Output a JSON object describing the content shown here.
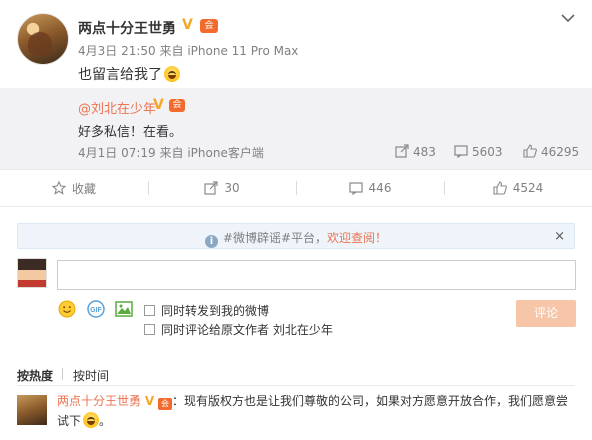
{
  "post": {
    "author": "两点十分王世勇",
    "time": "4月3日 21:50",
    "source_prefix": "来自",
    "source": "iPhone 11 Pro Max",
    "text": "也留言给我了"
  },
  "quoted": {
    "author": "@刘北在少年",
    "text": "好多私信！在看。",
    "time": "4月1日 07:19",
    "source_prefix": "来自",
    "source": "iPhone客户端",
    "reposts": "483",
    "comments": "5603",
    "likes": "46295"
  },
  "actions": {
    "favorite": "收藏",
    "repost": "30",
    "comment": "446",
    "like": "4524"
  },
  "notice": {
    "prefix": "#微博辟谣#平台，",
    "link": "欢迎查阅！",
    "close": "×"
  },
  "composer": {
    "option_repost": "同时转发到我的微博",
    "option_comment_to_author": "同时评论给原文作者 刘北在少年",
    "submit": "评论"
  },
  "sort": {
    "hot": "按热度",
    "time": "按时间"
  },
  "comments": [
    {
      "author": "两点十分王世勇",
      "text": "：现有版权方也是让我们尊敬的公司，如果对方愿意开放合作，我们愿意尝试下"
    }
  ],
  "colors": {
    "accent_orange": "#eb7350",
    "verified_gold": "#f5a623",
    "submit_disabled": "#f7c5a7"
  },
  "icons": [
    "chevron-down-icon",
    "repost-icon",
    "comment-icon",
    "like-icon",
    "favorite-icon",
    "info-icon",
    "emoji-icon",
    "gif-icon",
    "image-icon"
  ]
}
